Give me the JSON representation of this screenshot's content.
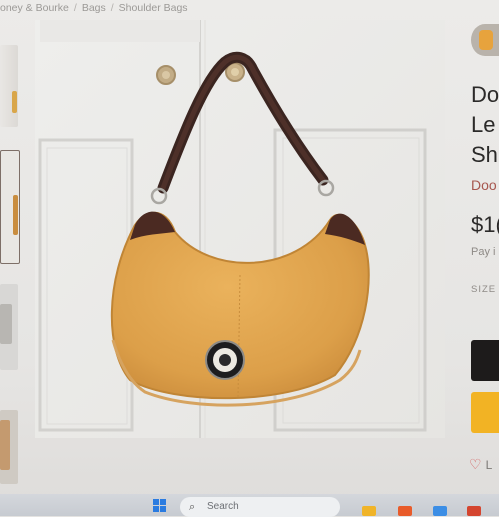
{
  "breadcrumb": {
    "items": [
      "oney & Bourke",
      "Bags",
      "Shoulder Bags"
    ],
    "separator": "/"
  },
  "product": {
    "title_lines": [
      "Do",
      "Le",
      "Sh"
    ],
    "brand": "Doo",
    "price": "$1(",
    "pay_text": "Pay i",
    "size_label": "SIZE",
    "like_label": "L"
  },
  "taskbar": {
    "search_label": "Search"
  },
  "colors": {
    "bag_leather": "#e0a44e",
    "bag_trim": "#4b2a22",
    "buy_button": "#1d1b1b",
    "offer_button": "#f2b324",
    "brand_link": "#a7574f"
  },
  "icons": {
    "like": "heart-icon",
    "search": "search-icon",
    "start": "windows-start-icon"
  }
}
